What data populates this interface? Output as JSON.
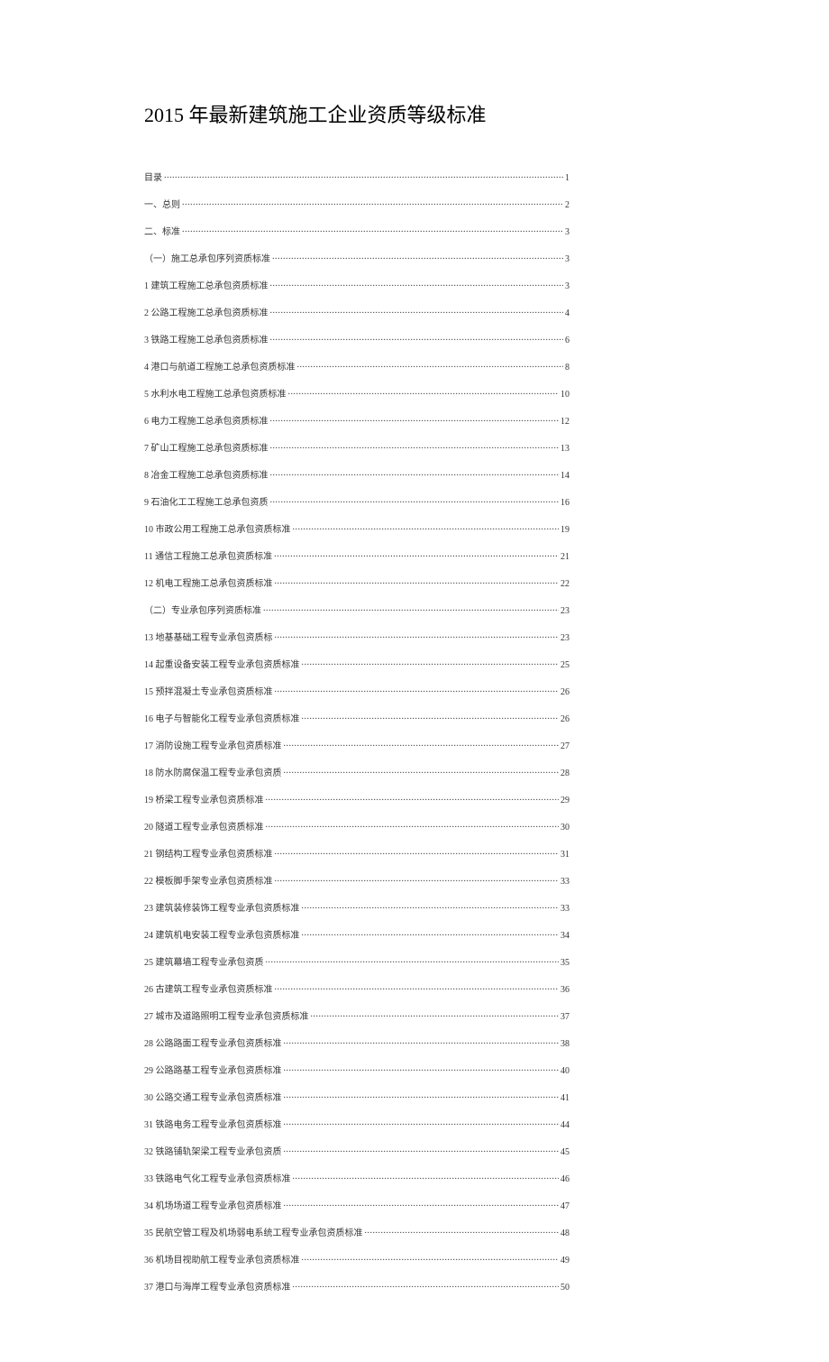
{
  "title": "2015 年最新建筑施工企业资质等级标准",
  "toc": [
    {
      "label": "目录",
      "page": "1"
    },
    {
      "label": "一、总则",
      "page": "2"
    },
    {
      "label": "二、标准",
      "page": "3"
    },
    {
      "label": "（一）施工总承包序列资质标准",
      "page": "3"
    },
    {
      "label": "1 建筑工程施工总承包资质标准",
      "page": "3"
    },
    {
      "label": "2 公路工程施工总承包资质标准",
      "page": "4"
    },
    {
      "label": "3 铁路工程施工总承包资质标准",
      "page": "6"
    },
    {
      "label": "4 港口与航道工程施工总承包资质标准",
      "page": "8"
    },
    {
      "label": "5 水利水电工程施工总承包资质标准",
      "page": "10"
    },
    {
      "label": "6 电力工程施工总承包资质标准",
      "page": "12"
    },
    {
      "label": "7 矿山工程施工总承包资质标准",
      "page": "13"
    },
    {
      "label": "8 冶金工程施工总承包资质标准",
      "page": "14"
    },
    {
      "label": "9 石油化工工程施工总承包资质",
      "page": "16"
    },
    {
      "label": "10 市政公用工程施工总承包资质标准",
      "page": "19"
    },
    {
      "label": "11 通信工程施工总承包资质标准",
      "page": "21"
    },
    {
      "label": "12 机电工程施工总承包资质标准",
      "page": "22"
    },
    {
      "label": "（二）专业承包序列资质标准",
      "page": "23"
    },
    {
      "label": "13 地基基础工程专业承包资质标",
      "page": "23"
    },
    {
      "label": "14 起重设备安装工程专业承包资质标准",
      "page": "25"
    },
    {
      "label": "15 预拌混凝土专业承包资质标准",
      "page": "26"
    },
    {
      "label": "16 电子与智能化工程专业承包资质标准",
      "page": "26"
    },
    {
      "label": "17 消防设施工程专业承包资质标准",
      "page": "27"
    },
    {
      "label": "18 防水防腐保温工程专业承包资质",
      "page": "28"
    },
    {
      "label": "19 桥梁工程专业承包资质标准",
      "page": "29"
    },
    {
      "label": "20 隧道工程专业承包资质标准",
      "page": "30"
    },
    {
      "label": "21 钢结构工程专业承包资质标准",
      "page": "31"
    },
    {
      "label": "22 模板脚手架专业承包资质标准",
      "page": "33"
    },
    {
      "label": "23 建筑装修装饰工程专业承包资质标准",
      "page": "33"
    },
    {
      "label": "24 建筑机电安装工程专业承包资质标准",
      "page": "34"
    },
    {
      "label": "25 建筑幕墙工程专业承包资质",
      "page": "35"
    },
    {
      "label": "26 古建筑工程专业承包资质标准",
      "page": "36"
    },
    {
      "label": "27 城市及道路照明工程专业承包资质标准",
      "page": "37"
    },
    {
      "label": "28 公路路面工程专业承包资质标准",
      "page": "38"
    },
    {
      "label": "29 公路路基工程专业承包资质标准",
      "page": "40"
    },
    {
      "label": "30 公路交通工程专业承包资质标准",
      "page": "41"
    },
    {
      "label": "31 铁路电务工程专业承包资质标准",
      "page": "44"
    },
    {
      "label": "32 铁路铺轨架梁工程专业承包资质",
      "page": "45"
    },
    {
      "label": "33 铁路电气化工程专业承包资质标准",
      "page": "46"
    },
    {
      "label": "34 机场场道工程专业承包资质标准",
      "page": "47"
    },
    {
      "label": "35 民航空管工程及机场弱电系统工程专业承包资质标准",
      "page": "48"
    },
    {
      "label": "36 机场目视助航工程专业承包资质标准",
      "page": "49"
    },
    {
      "label": "37 港口与海岸工程专业承包资质标准",
      "page": "50"
    }
  ]
}
